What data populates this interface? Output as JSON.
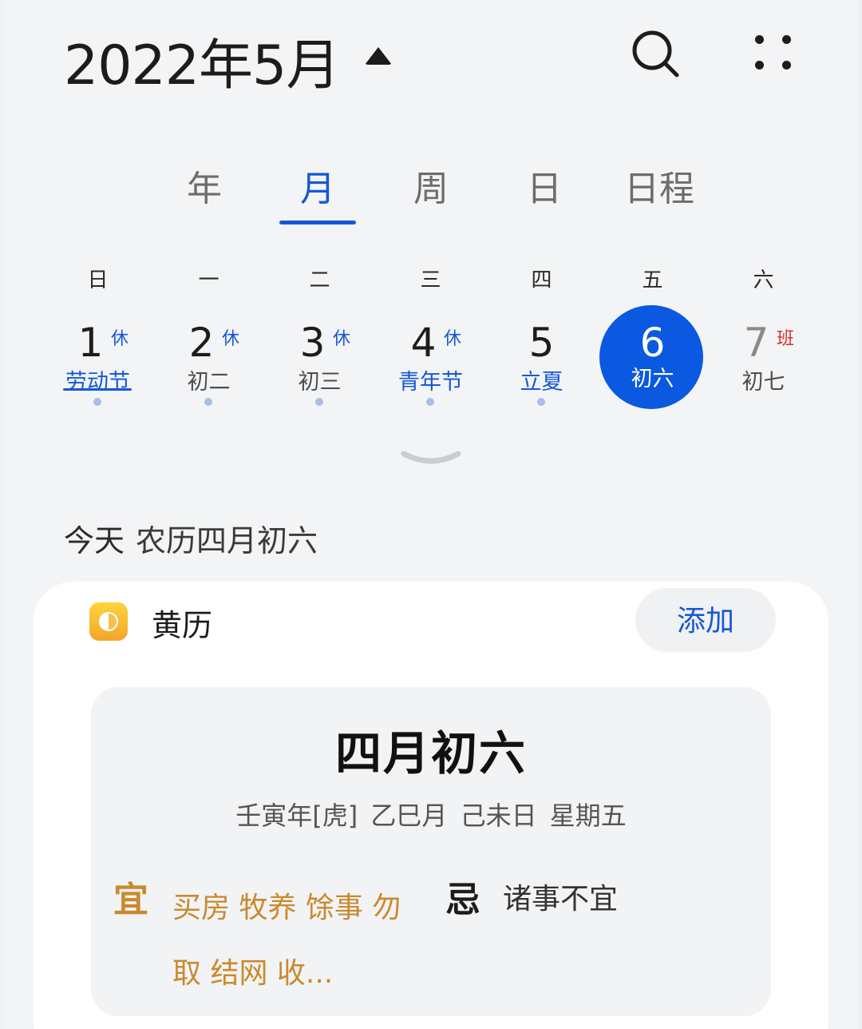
{
  "header": {
    "title": "2022年5月",
    "search_icon": "search-icon",
    "more_icon": "more-dots-icon"
  },
  "tabs": [
    {
      "label": "年"
    },
    {
      "label": "月",
      "active": true
    },
    {
      "label": "周"
    },
    {
      "label": "日"
    },
    {
      "label": "日程"
    }
  ],
  "weekdays": [
    "日",
    "一",
    "二",
    "三",
    "四",
    "五",
    "六"
  ],
  "days": [
    {
      "num": "1",
      "badge": "休",
      "sub": "劳动节",
      "holiday": true,
      "dot": true
    },
    {
      "num": "2",
      "badge": "休",
      "sub": "初二",
      "holiday": false,
      "dot": true
    },
    {
      "num": "3",
      "badge": "休",
      "sub": "初三",
      "holiday": false,
      "dot": true
    },
    {
      "num": "4",
      "badge": "休",
      "sub": "青年节",
      "holiday": true,
      "dot": true
    },
    {
      "num": "5",
      "badge": "",
      "sub": "立夏",
      "holiday": true,
      "dot": true
    },
    {
      "num": "6",
      "badge": "",
      "sub": "初六",
      "holiday": false,
      "dot": false,
      "selected": true
    },
    {
      "num": "7",
      "badge": "班",
      "sub": "初七",
      "holiday": false,
      "dot": false
    }
  ],
  "today": {
    "label": "今天",
    "lunar": "农历四月初六"
  },
  "almanac": {
    "title": "黄历",
    "add_label": "添加",
    "lunar_date": "四月初六",
    "ganzhi": "壬寅年[虎]  乙巳月 己未日 星期五",
    "yi_label": "宜",
    "yi_text": "买房 牧养 馀事 勿取 结网 收...",
    "ji_label": "忌",
    "ji_text": "诸事不宜"
  },
  "colors": {
    "accent": "#1558d6",
    "selected": "#0a59e0",
    "yi": "#c98a2e",
    "work_badge": "#d93025"
  }
}
